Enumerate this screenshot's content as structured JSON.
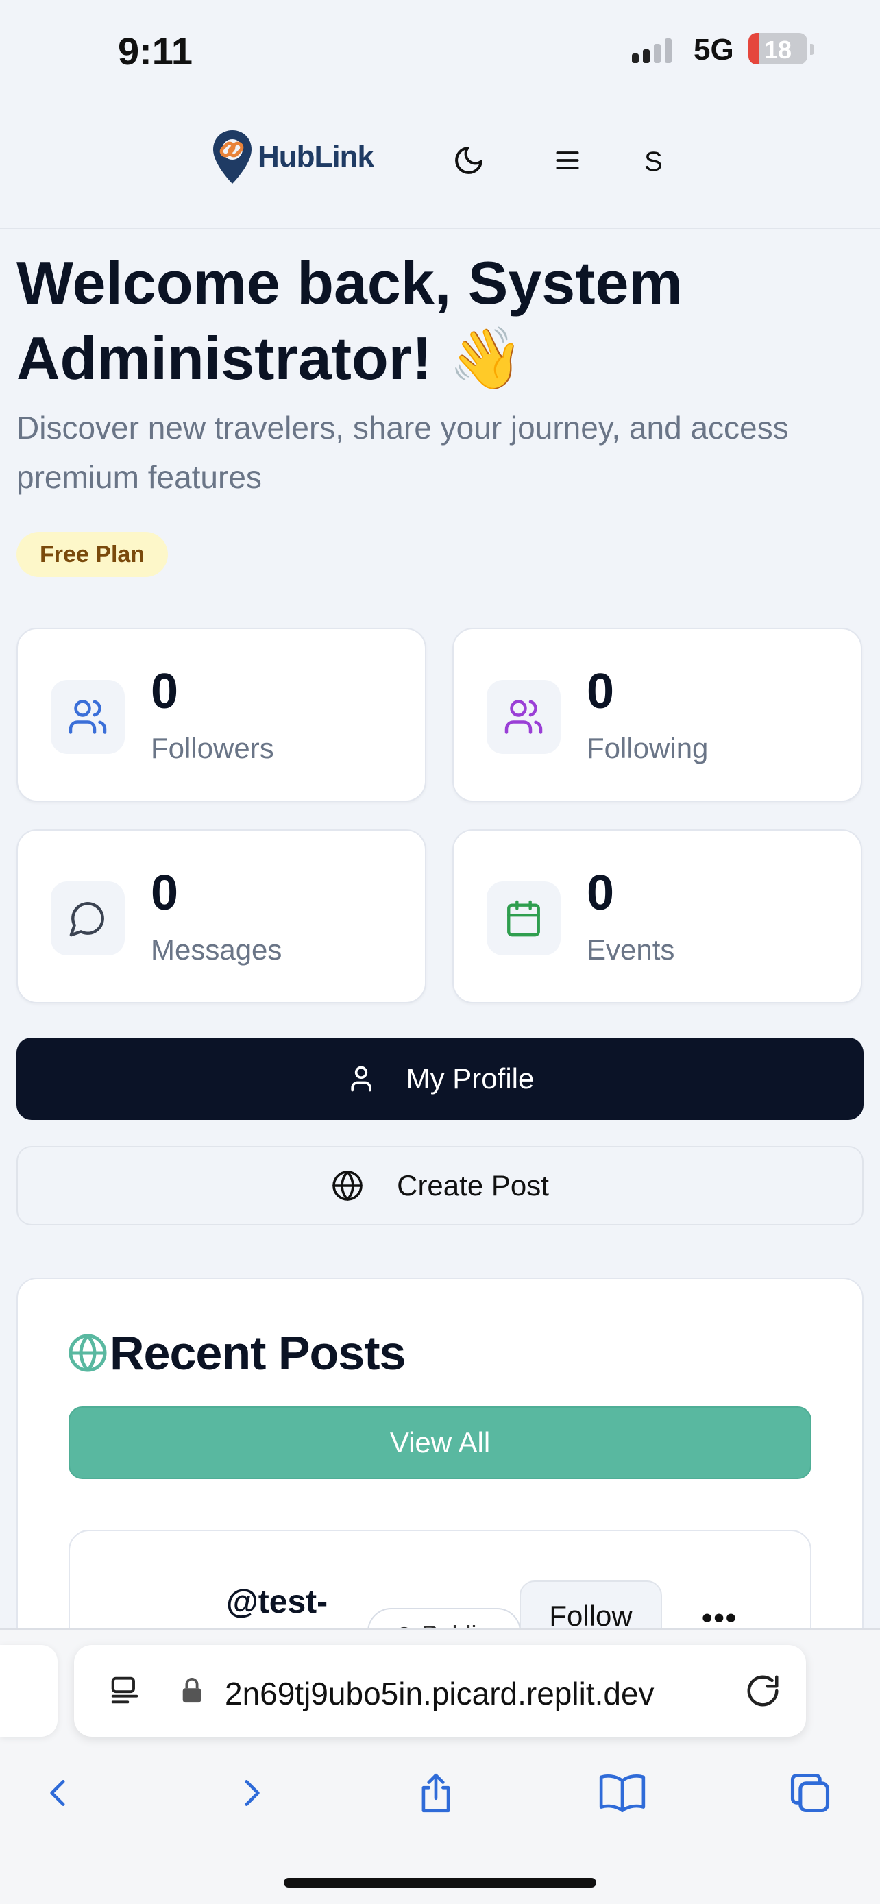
{
  "status_bar": {
    "time": "9:11",
    "network": "5G",
    "battery": "18",
    "battery_level": 0.18,
    "battery_color": "#e5463d"
  },
  "header": {
    "logo_text": "HubLink",
    "avatar_initial": "S",
    "icons": [
      "moon-icon",
      "menu-icon"
    ]
  },
  "welcome": {
    "title": "Welcome back, System Administrator! 👋",
    "subtitle": "Discover new travelers, share your journey, and access premium features",
    "plan_badge": "Free Plan"
  },
  "stats": [
    {
      "value": "0",
      "label": "Followers",
      "icon": "users-icon",
      "color": "#3b6fd8"
    },
    {
      "value": "0",
      "label": "Following",
      "icon": "users-icon",
      "color": "#9a3fd6"
    },
    {
      "value": "0",
      "label": "Messages",
      "icon": "message-circle-icon",
      "color": "#3b4352"
    },
    {
      "value": "0",
      "label": "Events",
      "icon": "calendar-icon",
      "color": "#2f9e4f"
    }
  ],
  "actions": {
    "my_profile": "My Profile",
    "create_post": "Create Post"
  },
  "recent_posts": {
    "title": "Recent Posts",
    "view_all": "View All",
    "accent": "#59b8a0",
    "first_post": {
      "username": "@test-",
      "visibility": "Public",
      "follow": "Follow",
      "more": "•••"
    }
  },
  "browser": {
    "url": "2n69tj9ubo5in.picard.replit.dev"
  }
}
